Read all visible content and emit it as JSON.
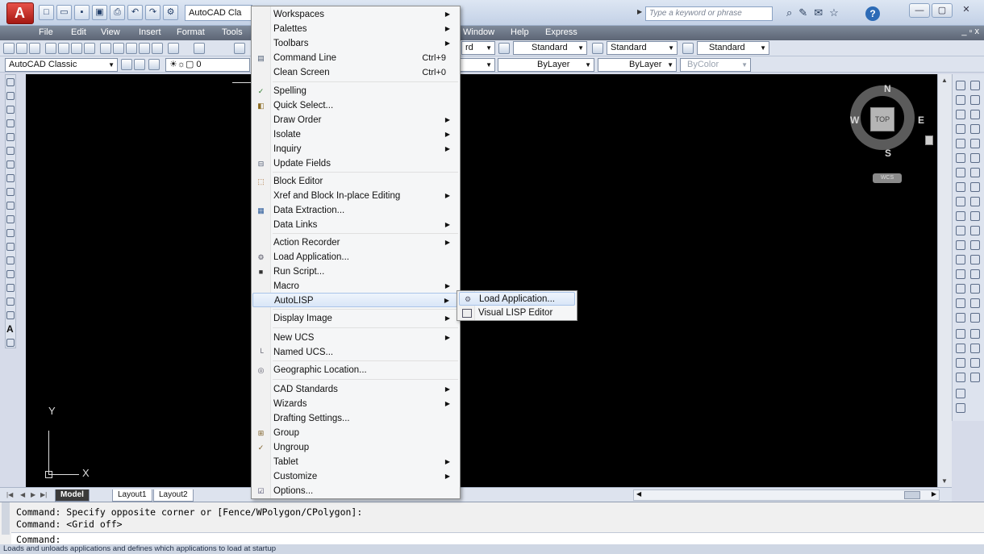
{
  "titlebar": {
    "workspace_combo": "AutoCAD Cla",
    "search_placeholder": "Type a keyword or phrase",
    "help_label": "?"
  },
  "menubar": [
    "File",
    "Edit",
    "View",
    "Insert",
    "Format",
    "Tools",
    "Window",
    "Help",
    "Express"
  ],
  "toolbar1": {
    "combos": [
      "rd",
      "Standard",
      "Standard",
      "Standard"
    ]
  },
  "toolbar2": {
    "workspace": "AutoCAD Classic",
    "layer": "0",
    "linetype": "ByLayer",
    "lineweight": "ByLayer",
    "plotstyle": "ByColor"
  },
  "viewcube": {
    "north": "N",
    "south": "S",
    "east": "E",
    "west": "W",
    "top": "TOP",
    "wcs": "WCS"
  },
  "ucs": {
    "x": "X",
    "y": "Y"
  },
  "layout_tabs": [
    "Model",
    "Layout1",
    "Layout2"
  ],
  "command": {
    "history": [
      "Command: Specify opposite corner or [Fence/WPolygon/CPolygon]:",
      "Command:  <Grid off>"
    ],
    "prompt": "Command:"
  },
  "status_text": "Loads and unloads applications and defines which applications to load at startup",
  "tools_menu": {
    "items": [
      {
        "label": "Workspaces",
        "sub": true
      },
      {
        "label": "Palettes",
        "sub": true
      },
      {
        "label": "Toolbars",
        "sub": true
      },
      {
        "label": "Command Line",
        "shortcut": "Ctrl+9",
        "icon": "command-line-icon"
      },
      {
        "label": "Clean Screen",
        "shortcut": "Ctrl+0"
      },
      {
        "label": "Spelling",
        "icon": "spelling-icon"
      },
      {
        "label": "Quick Select...",
        "icon": "quick-select-icon"
      },
      {
        "label": "Draw Order",
        "sub": true
      },
      {
        "label": "Isolate",
        "sub": true
      },
      {
        "label": "Inquiry",
        "sub": true
      },
      {
        "label": "Update Fields",
        "icon": "update-fields-icon"
      },
      {
        "label": "Block Editor",
        "icon": "block-editor-icon"
      },
      {
        "label": "Xref and Block In-place Editing",
        "sub": true
      },
      {
        "label": "Data Extraction...",
        "icon": "data-extraction-icon"
      },
      {
        "label": "Data Links",
        "sub": true
      },
      {
        "label": "Action Recorder",
        "sub": true
      },
      {
        "label": "Load Application...",
        "icon": "load-application-icon"
      },
      {
        "label": "Run Script...",
        "icon": "run-script-icon"
      },
      {
        "label": "Macro",
        "sub": true
      },
      {
        "label": "AutoLISP",
        "sub": true
      },
      {
        "label": "Display Image",
        "sub": true
      },
      {
        "label": "New UCS",
        "sub": true
      },
      {
        "label": "Named UCS...",
        "icon": "named-ucs-icon"
      },
      {
        "label": "Geographic Location...",
        "icon": "geographic-location-icon"
      },
      {
        "label": "CAD Standards",
        "sub": true
      },
      {
        "label": "Wizards",
        "sub": true
      },
      {
        "label": "Drafting Settings..."
      },
      {
        "label": "Group",
        "icon": "group-icon"
      },
      {
        "label": "Ungroup",
        "icon": "ungroup-icon"
      },
      {
        "label": "Tablet",
        "sub": true
      },
      {
        "label": "Customize",
        "sub": true
      },
      {
        "label": "Options...",
        "icon": "options-icon"
      }
    ]
  },
  "autolisp_submenu": {
    "items": [
      {
        "label": "Load Application..."
      },
      {
        "label": "Visual LISP Editor"
      }
    ]
  },
  "colors": {
    "canvas": "#000000",
    "menu_highlight": "#d9e6f7",
    "menubar": "#6b7585",
    "app_logo": "#c8231c"
  }
}
